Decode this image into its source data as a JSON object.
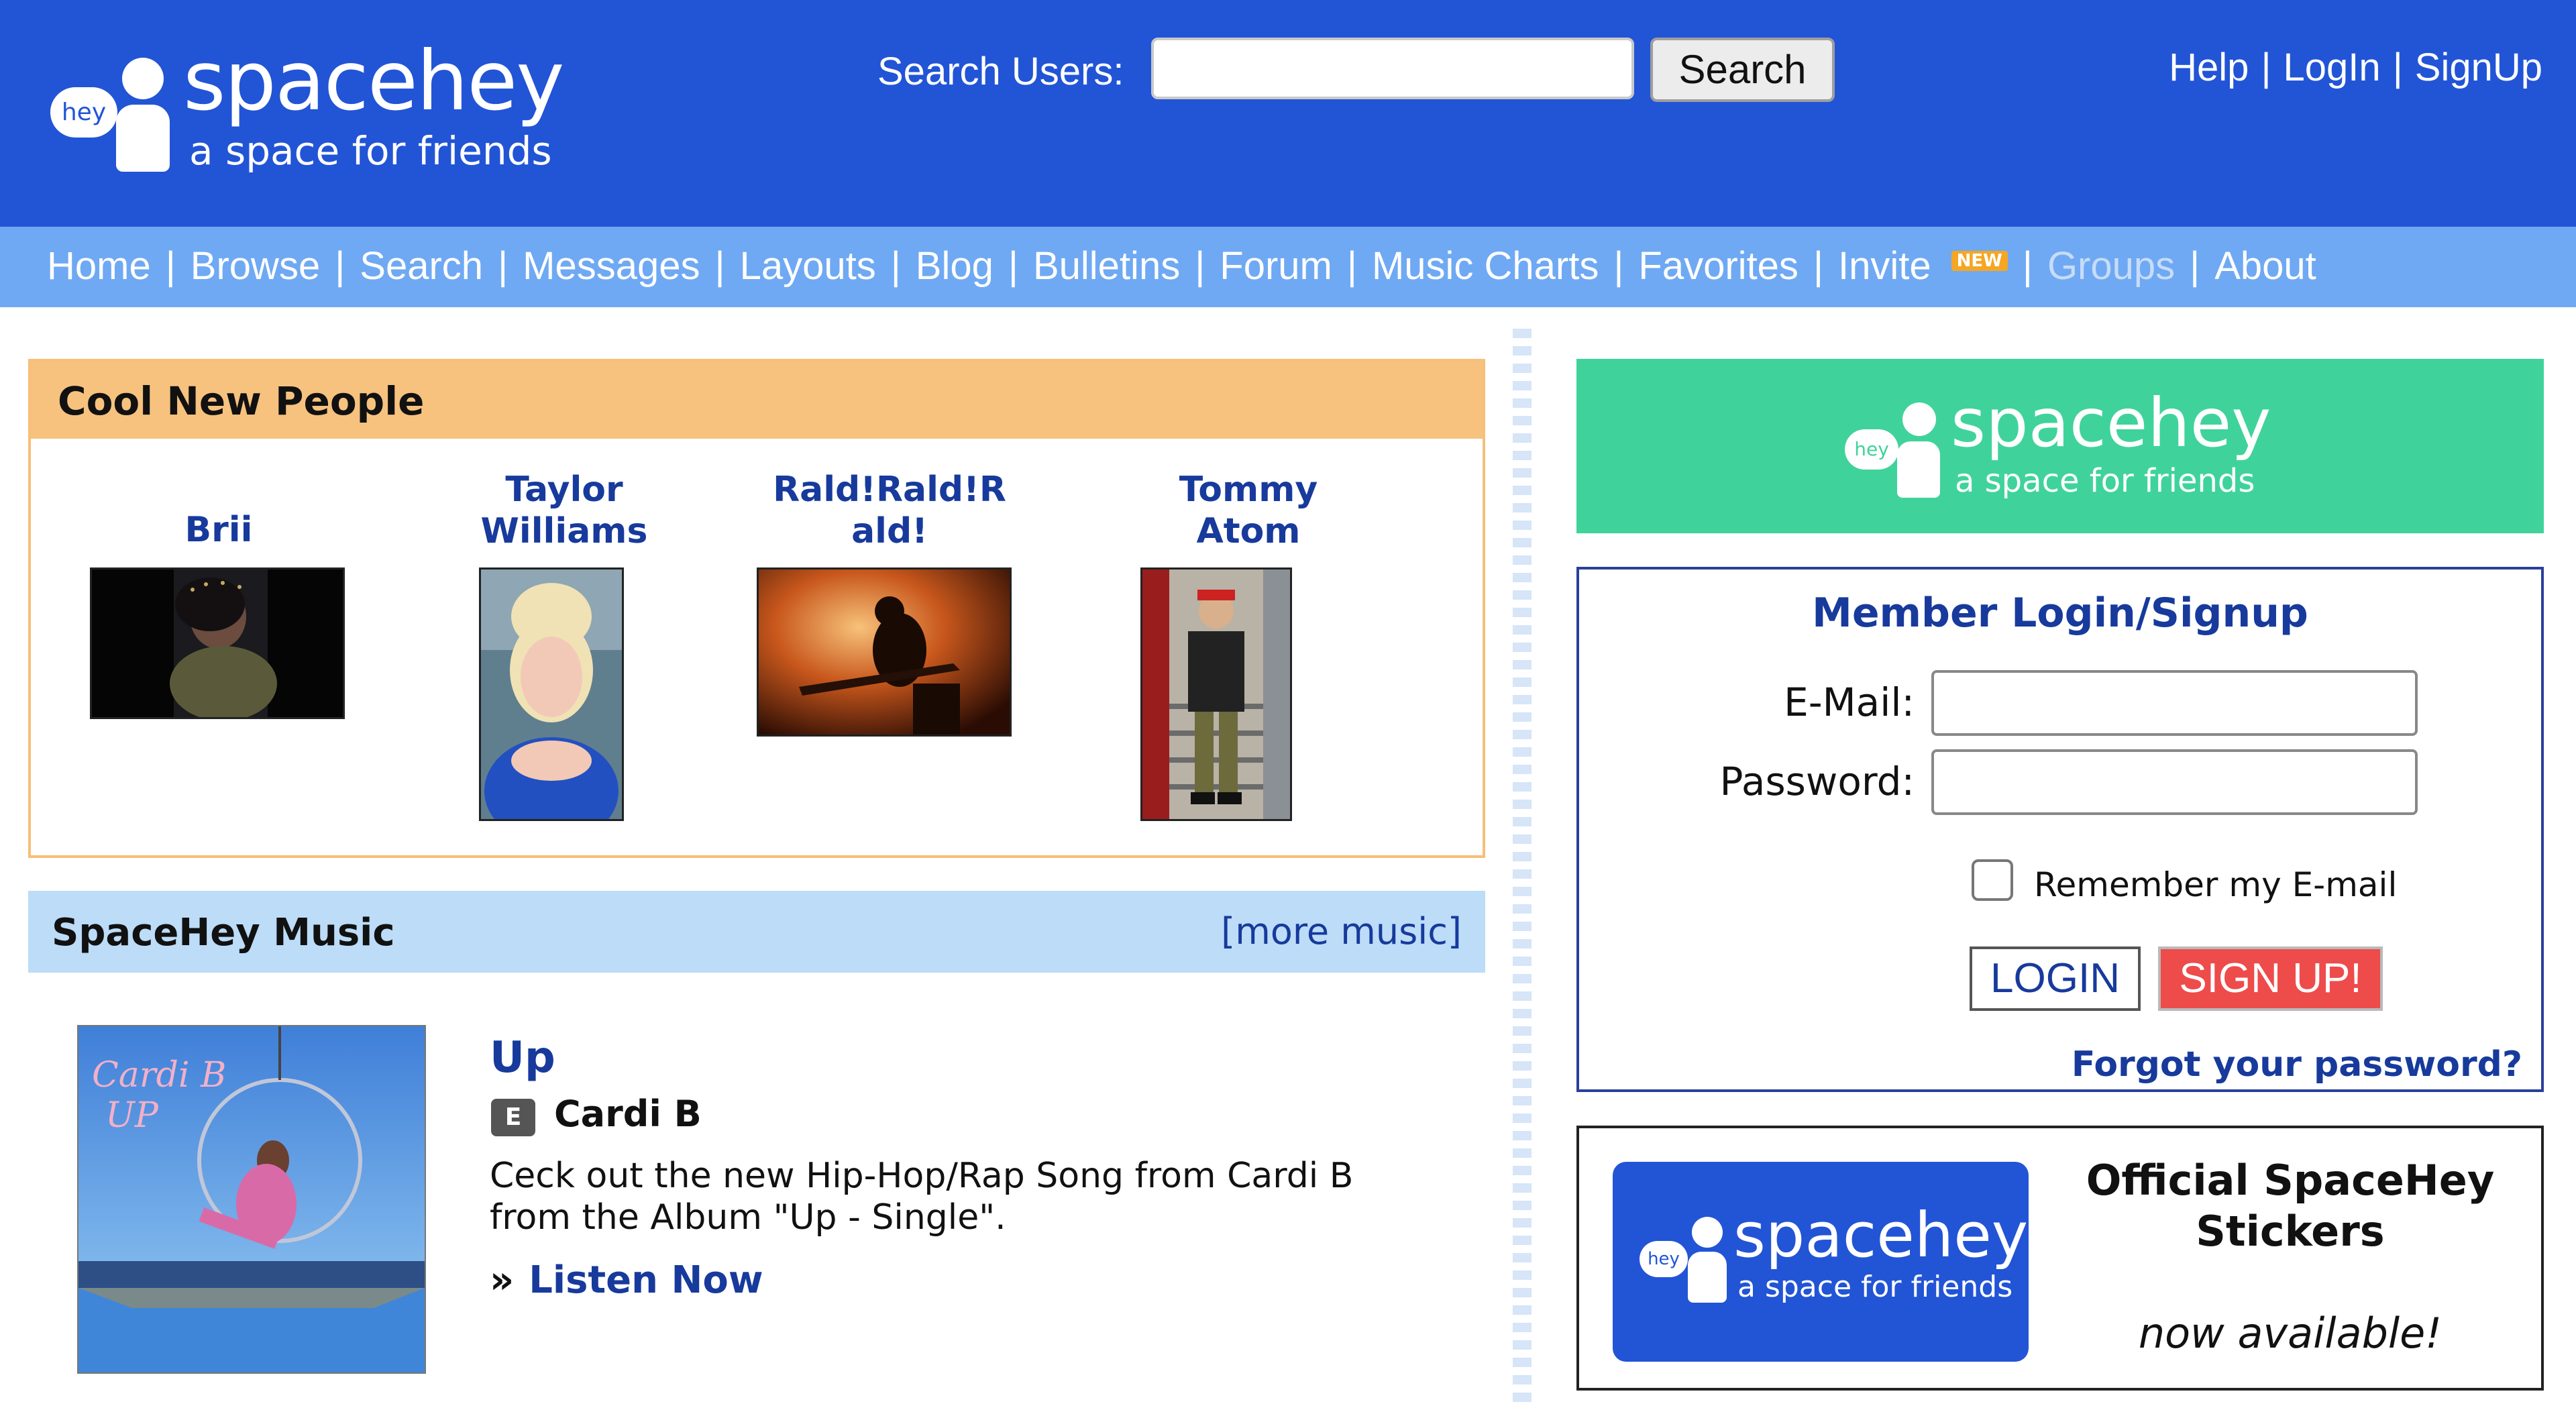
{
  "header": {
    "logo_bubble": "hey",
    "brand": "spacehey",
    "tagline": "a space for friends",
    "search_label": "Search Users:",
    "search_button": "Search",
    "links": [
      "Help",
      "LogIn",
      "SignUp"
    ],
    "colors": {
      "header_bg": "#2254d6",
      "nav_bg": "#6fa9f3"
    }
  },
  "nav": {
    "items": [
      "Home",
      "Browse",
      "Search",
      "Messages",
      "Layouts",
      "Blog",
      "Bulletins",
      "Forum",
      "Music Charts",
      "Favorites",
      "Invite",
      "Groups",
      "About"
    ],
    "invite_badge": "NEW"
  },
  "cool_new_people": {
    "title": "Cool New People",
    "people": [
      {
        "name": "Brii"
      },
      {
        "name": "Taylor Williams"
      },
      {
        "name": "Rald!Rald!Rald!"
      },
      {
        "name": "Tommy Atom"
      }
    ]
  },
  "music": {
    "title": "SpaceHey Music",
    "more_link": "[more music]",
    "song_title": "Up",
    "explicit_badge": "E",
    "artist": "Cardi B",
    "description": "Ceck out the new Hip-Hop/Rap Song from Cardi B from the Album \"Up - Single\".",
    "listen_marker": "»",
    "listen_link": "Listen Now"
  },
  "banner": {
    "logo_bubble": "hey",
    "brand": "spacehey",
    "tagline": "a space for friends",
    "color": "#3fd39b"
  },
  "login": {
    "title": "Member Login/Signup",
    "email_label": "E-Mail:",
    "password_label": "Password:",
    "remember_label": "Remember my E-mail",
    "login_button": "LOGIN",
    "signup_button": "SIGN UP!",
    "forgot_link": "Forgot your password?"
  },
  "stickers": {
    "logo_bubble": "hey",
    "brand": "spacehey",
    "tagline": "a space for friends",
    "title": "Official SpaceHey Stickers",
    "subtitle": "now available!"
  }
}
